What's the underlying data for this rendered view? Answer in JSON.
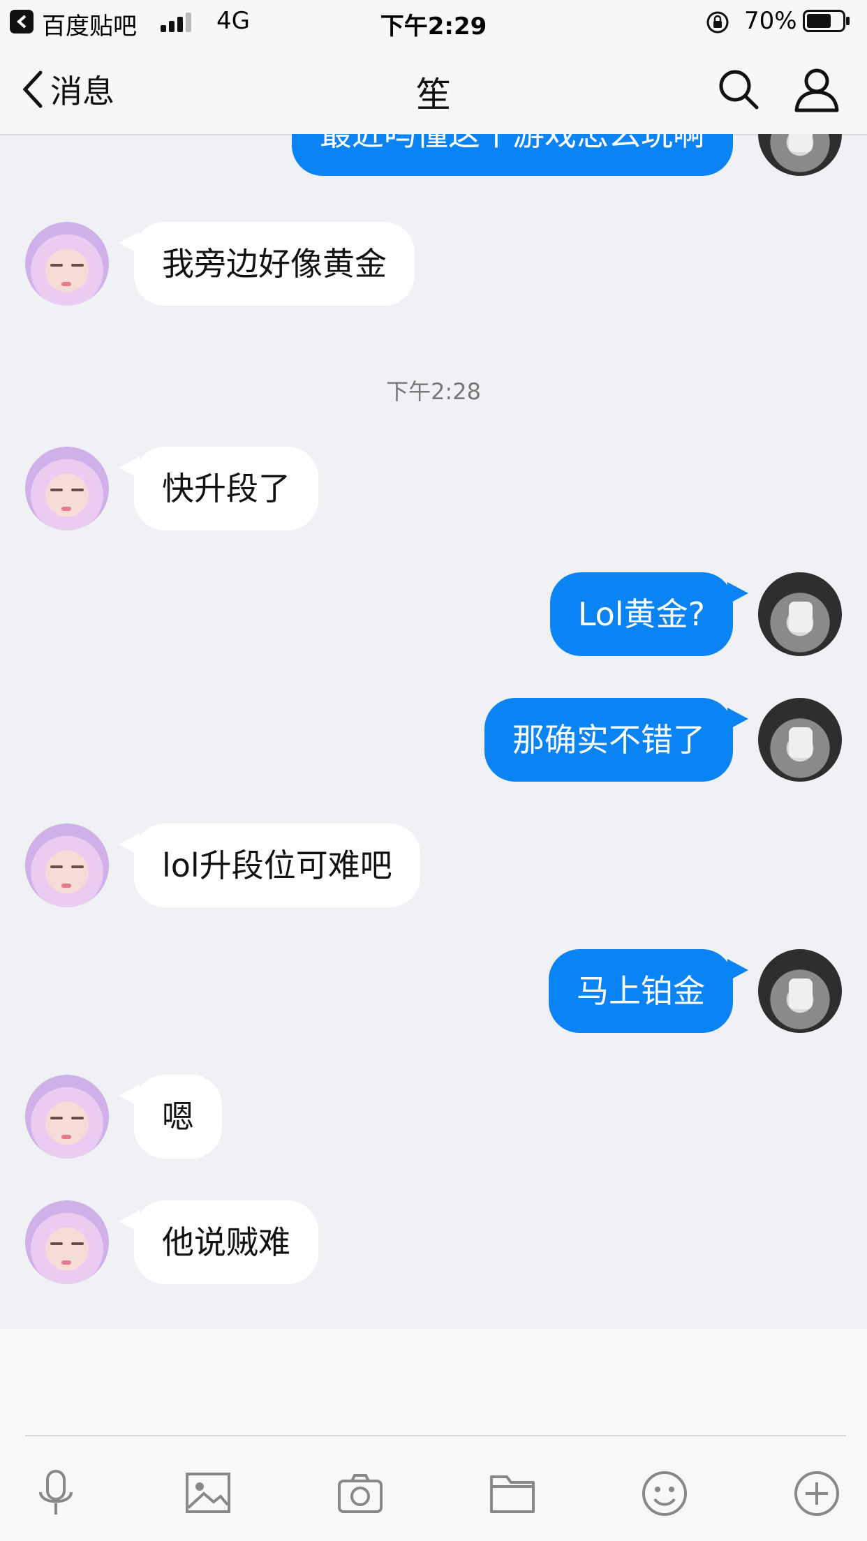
{
  "status_bar": {
    "app_name": "百度贴吧",
    "network": "4G",
    "time": "下午2:29",
    "battery_percent": "70%",
    "battery_level": 0.7,
    "signal_bars": 3
  },
  "nav": {
    "back_label": "消息",
    "title": "笙",
    "icons": [
      "chevron-left-icon",
      "search-icon",
      "user-icon"
    ]
  },
  "chat": {
    "timestamp": "下午2:28",
    "messages": [
      {
        "side": "out",
        "text": "最近吗懂这个游戏怎么玩啊"
      },
      {
        "side": "in",
        "text": "我旁边好像黄金"
      },
      {
        "side": "in",
        "text": "快升段了"
      },
      {
        "side": "out",
        "text": "Lol黄金?"
      },
      {
        "side": "out",
        "text": "那确实不错了"
      },
      {
        "side": "in",
        "text": "lol升段位可难吧"
      },
      {
        "side": "out",
        "text": "马上铂金"
      },
      {
        "side": "in",
        "text": "嗯"
      },
      {
        "side": "in",
        "text": "他说贼难"
      }
    ]
  },
  "toolbar": {
    "icons": [
      "microphone-icon",
      "image-icon",
      "camera-icon",
      "folder-icon",
      "emoji-icon",
      "plus-icon"
    ]
  },
  "colors": {
    "outgoing_bubble": "#0a84f5",
    "incoming_bubble": "#ffffff",
    "background": "#f0f1f5"
  }
}
